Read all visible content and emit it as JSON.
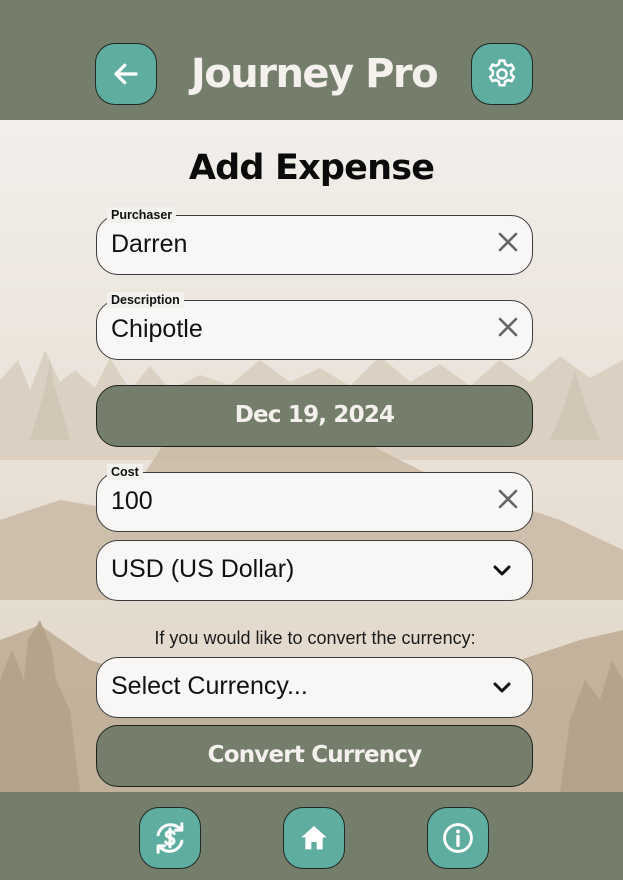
{
  "header": {
    "title": "Journey Pro",
    "back_icon": "arrow-left-icon",
    "settings_icon": "gear-icon"
  },
  "main": {
    "title": "Add Expense",
    "purchaser": {
      "label": "Purchaser",
      "value": "Darren"
    },
    "description": {
      "label": "Description",
      "value": "Chipotle"
    },
    "date_button": "Dec 19, 2024",
    "cost": {
      "label": "Cost",
      "value": "100"
    },
    "currency_select": "USD (US Dollar)",
    "convert_hint": "If you would like to convert the currency:",
    "target_currency_select": "Select Currency...",
    "convert_button": "Convert Currency"
  },
  "footer": {
    "items": [
      {
        "icon": "currency-exchange-icon"
      },
      {
        "icon": "home-icon"
      },
      {
        "icon": "info-icon"
      }
    ]
  },
  "colors": {
    "bar": "#747e6b",
    "accent": "#5fada1",
    "field_bg": "#f8f7f6",
    "page_bg": "#f1ede8"
  }
}
